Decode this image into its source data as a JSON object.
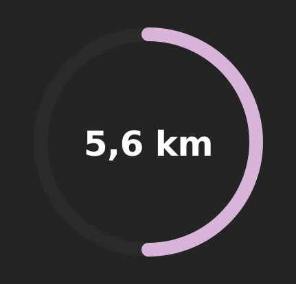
{
  "distance": {
    "value_text": "5,6 km",
    "progress_fraction": 0.5
  },
  "colors": {
    "background": "#242424",
    "track": "#2a2a2a",
    "progress": "#d8b4d8",
    "text": "#ffffff"
  }
}
